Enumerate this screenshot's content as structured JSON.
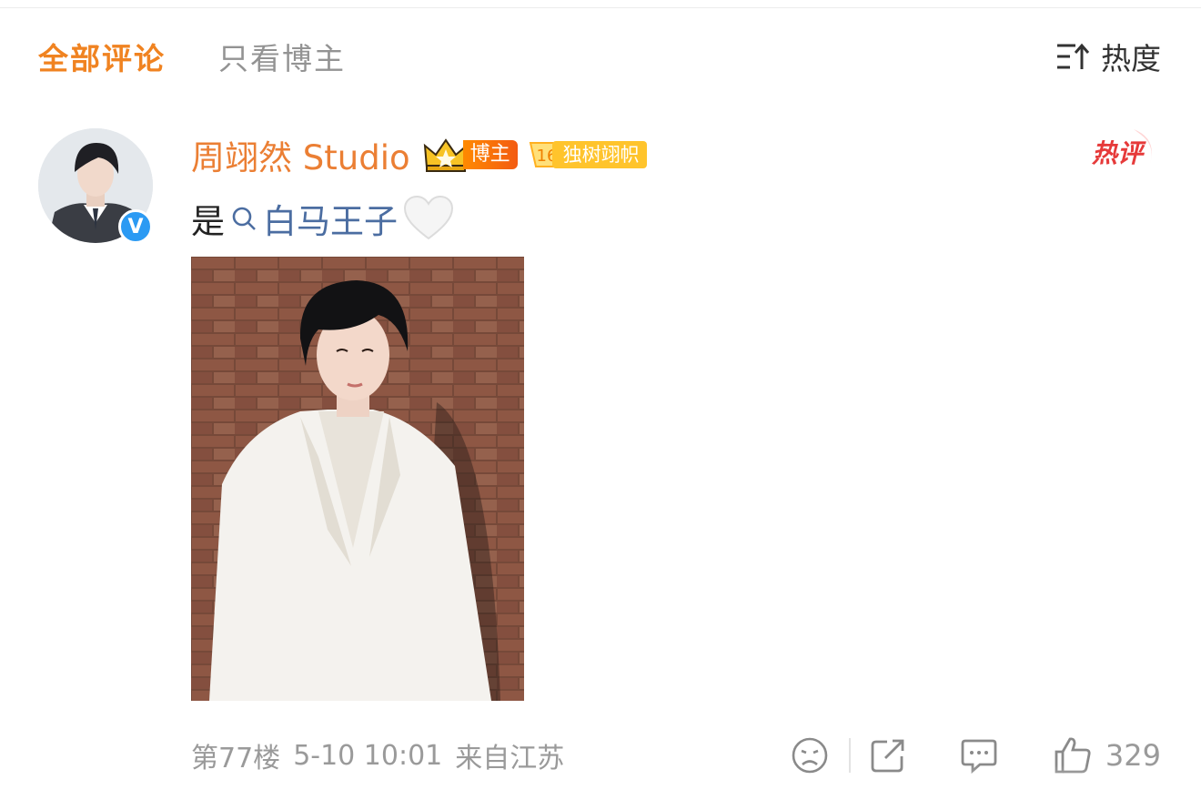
{
  "tabs": {
    "all_comments": "全部评论",
    "blogger_only": "只看博主"
  },
  "sort": {
    "label": "热度",
    "icon": "sort-icon"
  },
  "comment": {
    "username": "周翊然 Studio",
    "host_badge": "博主",
    "fan_level": "16",
    "fan_badge": "独树翊帜",
    "hot_tag": "热评",
    "text_prefix": "是",
    "topic": "白马王子",
    "floor": "第77楼",
    "datetime": "5-10 10:01",
    "location": "来自江苏",
    "likes": "329"
  },
  "colors": {
    "accent": "#f08321",
    "username": "#eb7f34",
    "topic": "#4b6da1",
    "meta": "#9a9a9a",
    "hot": "#e63a3a"
  }
}
